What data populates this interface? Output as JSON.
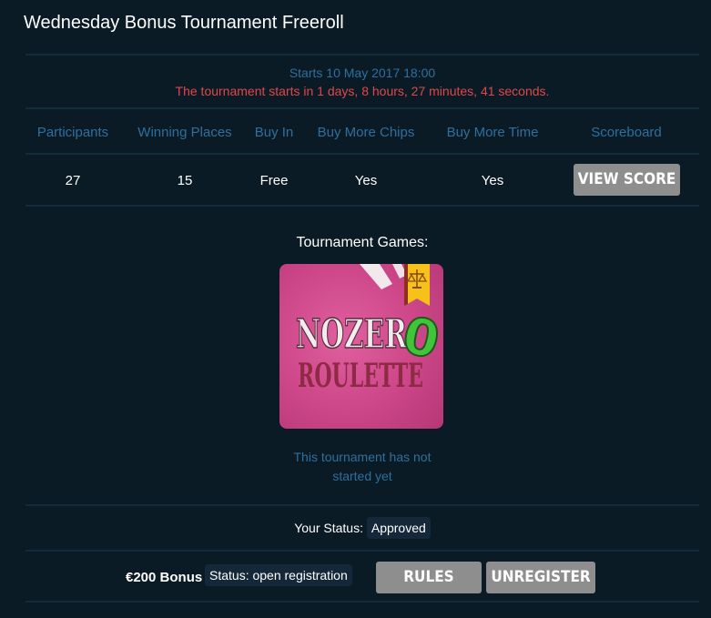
{
  "page": {
    "title": "Wednesday Bonus Tournament Freeroll"
  },
  "schedule": {
    "starts": "Starts 10 May 2017 18:00",
    "countdown": "The tournament starts in 1 days, 8 hours, 27 minutes, 41 seconds."
  },
  "stats": {
    "headers": [
      "Participants",
      "Winning Places",
      "Buy In",
      "Buy More Chips",
      "Buy More Time",
      "Scoreboard"
    ],
    "values": [
      "27",
      "15",
      "Free",
      "Yes",
      "Yes"
    ],
    "view_score_label": "VIEW SCORE"
  },
  "games": {
    "label": "Tournament Games:",
    "game": {
      "logo_line1": "NOZER",
      "logo_zero": "0",
      "logo_line2": "ROULETTE",
      "badge_icon": "scales-icon"
    },
    "not_started": [
      "This tournament has not",
      "started yet"
    ]
  },
  "status": {
    "label": "Your Status:",
    "value": "Approved"
  },
  "bonus": {
    "name": "€200 Bonus",
    "registration_status": "Status: open registration",
    "rules_label": "RULES",
    "unregister_label": "UNREGISTER"
  },
  "colors": {
    "background": "#0b1b26",
    "link_blue": "#2f6f9c",
    "countdown_red": "#e0474b",
    "button_gray": "#8e8e8e",
    "game_tile_pink": "#cc4688"
  }
}
